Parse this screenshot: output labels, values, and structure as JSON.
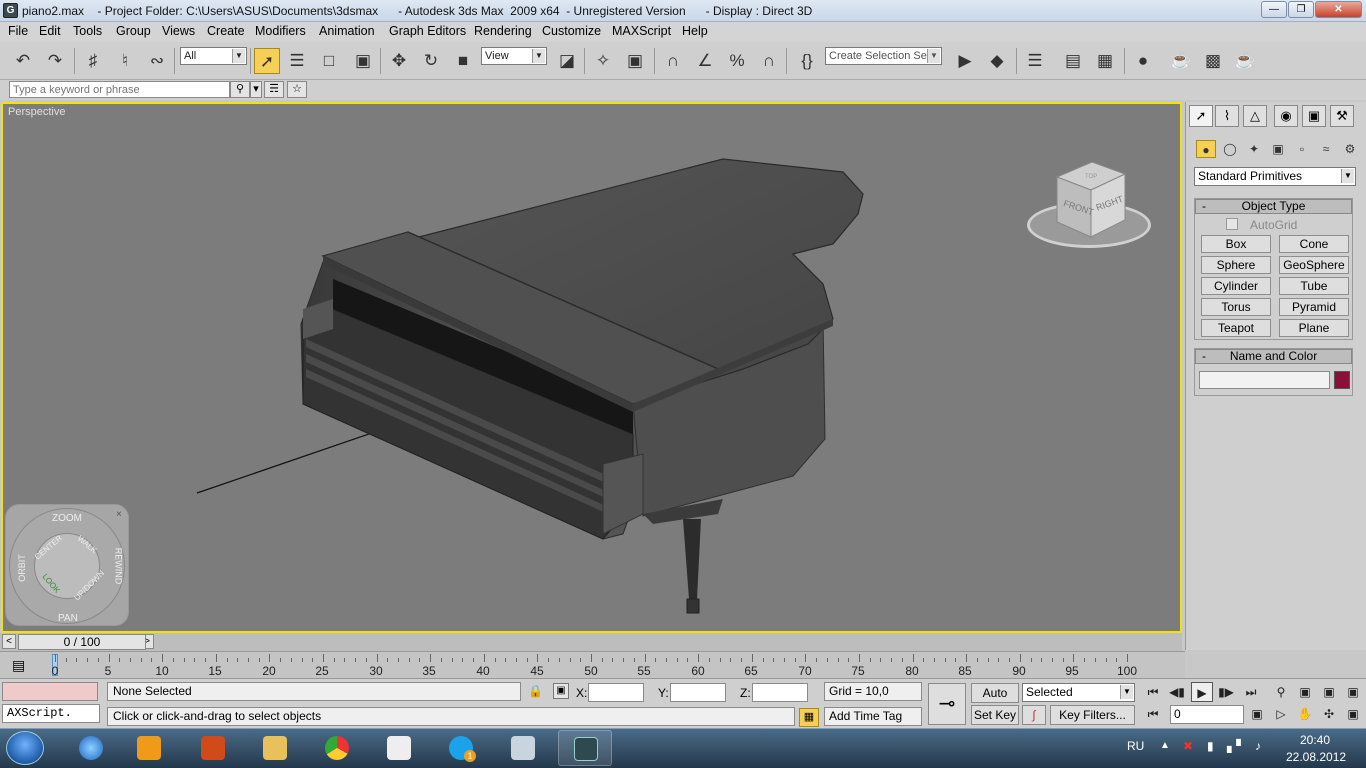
{
  "window": {
    "title": "piano2.max    - Project Folder: C:\\Users\\ASUS\\Documents\\3dsmax      - Autodesk 3ds Max  2009 x64  - Unregistered Version      - Display : Direct 3D",
    "app_icon": "G"
  },
  "menu": [
    "File",
    "Edit",
    "Tools",
    "Group",
    "Views",
    "Create",
    "Modifiers",
    "Animation",
    "Graph Editors",
    "Rendering",
    "Customize",
    "MAXScript",
    "Help"
  ],
  "toolbar": {
    "selection_filter": "All",
    "reference_coord": "View",
    "named_selection_placeholder": "Create Selection Set"
  },
  "search": {
    "placeholder": "Type a keyword or phrase"
  },
  "viewport": {
    "label": "Perspective",
    "viewcube": {
      "front": "FRONT",
      "right": "RIGHT",
      "top": "TOP"
    },
    "steering_wheel": {
      "zoom": "ZOOM",
      "orbit": "ORBIT",
      "center": "CENTER",
      "walk": "WALK",
      "look": "LOOK",
      "updown": "UP/DOWN",
      "rewind": "REWIND",
      "pan": "PAN"
    }
  },
  "command_panel": {
    "category": "Standard Primitives",
    "object_type_title": "Object Type",
    "autogrid_label": "AutoGrid",
    "buttons": [
      "Box",
      "Cone",
      "Sphere",
      "GeoSphere",
      "Cylinder",
      "Tube",
      "Torus",
      "Pyramid",
      "Teapot",
      "Plane"
    ],
    "name_color_title": "Name and Color",
    "object_name": "",
    "color": "#8a0f3a"
  },
  "timeline": {
    "slider": "0 / 100",
    "ticks": [
      "0",
      "5",
      "10",
      "15",
      "20",
      "25",
      "30",
      "35",
      "40",
      "45",
      "50",
      "55",
      "60",
      "65",
      "70",
      "75",
      "80",
      "85",
      "90",
      "95",
      "100"
    ]
  },
  "status": {
    "maxscript_listener": "AXScript.",
    "selection": "None Selected",
    "prompt": "Click or click-and-drag to select objects",
    "x_label": "X:",
    "y_label": "Y:",
    "z_label": "Z:",
    "grid": "Grid = 10,0",
    "add_time_tag": "Add Time Tag",
    "auto_key": "Auto Key",
    "set_key": "Set Key",
    "key_mode": "Selected",
    "key_filters": "Key Filters...",
    "current_frame": "0"
  },
  "taskbar": {
    "lang": "RU",
    "time": "20:40",
    "date": "22.08.2012",
    "skype_badge": "1"
  }
}
